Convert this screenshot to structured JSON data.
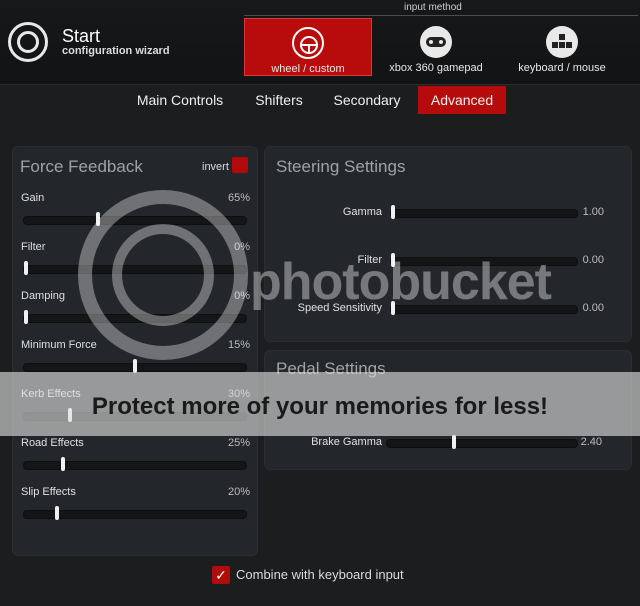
{
  "brand": {
    "title": "Start",
    "subtitle": "configuration wizard"
  },
  "input_method": {
    "label": "input method",
    "options": [
      {
        "label": "wheel / custom",
        "icon": "steering-wheel-icon",
        "active": true
      },
      {
        "label": "xbox 360 gamepad",
        "icon": "gamepad-icon",
        "active": false
      },
      {
        "label": "keyboard / mouse",
        "icon": "keyboard-icon",
        "active": false
      }
    ]
  },
  "tabs": [
    {
      "label": "Main Controls"
    },
    {
      "label": "Shifters"
    },
    {
      "label": "Secondary"
    },
    {
      "label": "Advanced",
      "active": true
    }
  ],
  "force_feedback": {
    "title": "Force Feedback",
    "invert_label": "invert",
    "sliders": [
      {
        "label": "Gain",
        "value": "65%",
        "level": 0.33
      },
      {
        "label": "Filter",
        "value": "0%",
        "level": 0.0
      },
      {
        "label": "Damping",
        "value": "0%",
        "level": 0.0
      },
      {
        "label": "Minimum Force",
        "value": "15%",
        "level": 0.5
      },
      {
        "label": "Kerb Effects",
        "value": "30%",
        "level": 0.2
      },
      {
        "label": "Road Effects",
        "value": "25%",
        "level": 0.17
      },
      {
        "label": "Slip Effects",
        "value": "20%",
        "level": 0.14
      }
    ]
  },
  "steering": {
    "title": "Steering Settings",
    "sliders": [
      {
        "label": "Gamma",
        "value": "1.00",
        "level": 0.0
      },
      {
        "label": "Filter",
        "value": "0.00",
        "level": 0.0
      },
      {
        "label": "Speed Sensitivity",
        "value": "0.00",
        "level": 0.0
      }
    ]
  },
  "pedal": {
    "title": "Pedal Settings",
    "sliders": [
      {
        "label": "Brake Gamma",
        "value": "2.40",
        "level": 0.35
      }
    ]
  },
  "combine": {
    "label": "Combine with keyboard input",
    "checked": true
  },
  "watermark": {
    "brand": "photobucket",
    "tagline": "Protect more of your memories for less!"
  },
  "colors": {
    "accent": "#b50b0b",
    "background": "#1b1d1f",
    "panel": "#23262a"
  }
}
